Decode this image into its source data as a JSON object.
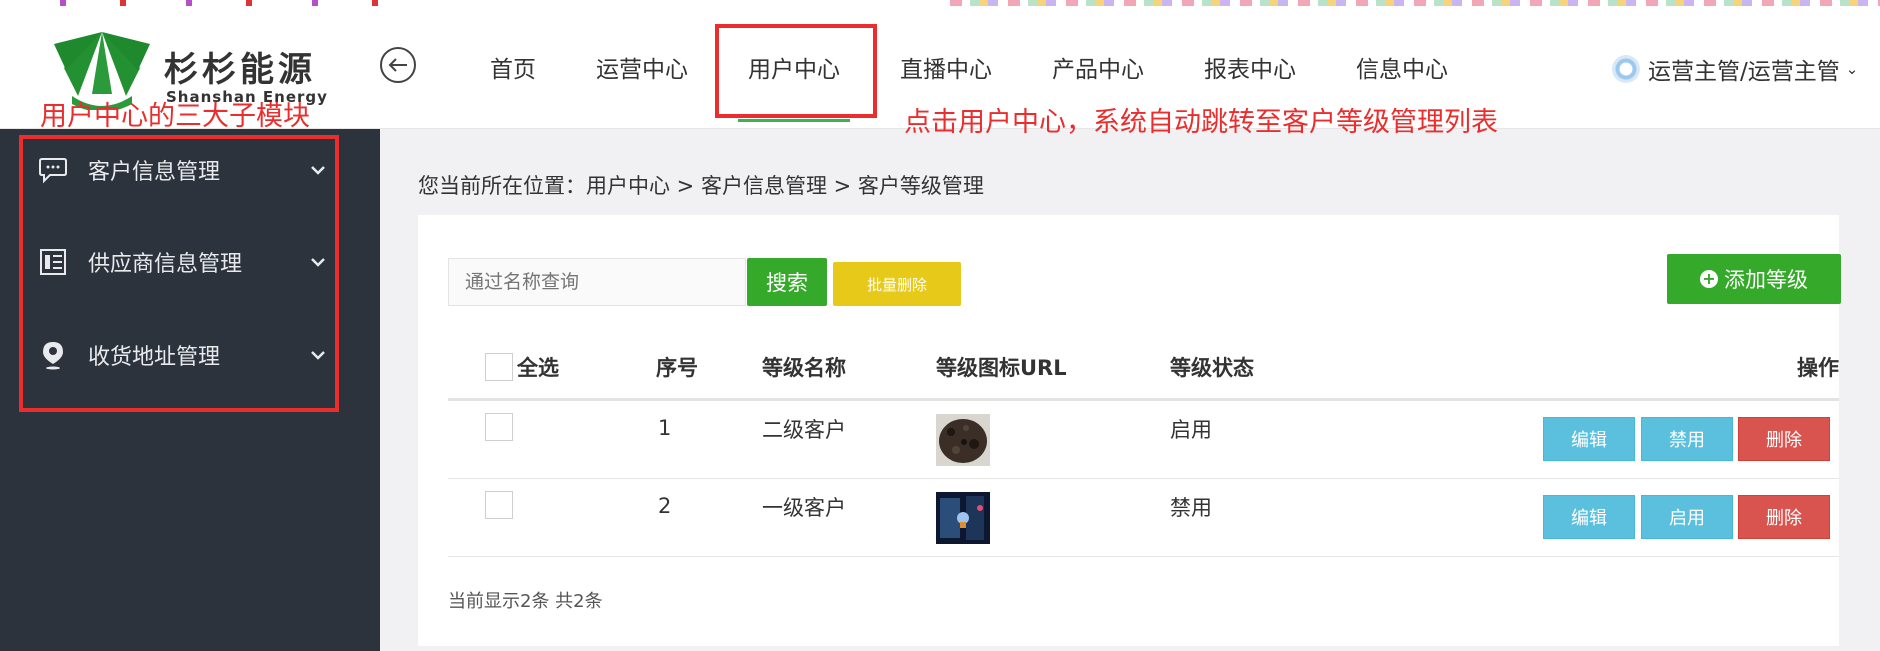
{
  "app": {
    "logo_cn": "杉杉能源",
    "logo_en": "Shanshan Energy"
  },
  "nav": {
    "items": [
      {
        "label": "首页"
      },
      {
        "label": "运营中心"
      },
      {
        "label": "用户中心",
        "active": true
      },
      {
        "label": "直播中心"
      },
      {
        "label": "产品中心"
      },
      {
        "label": "报表中心"
      },
      {
        "label": "信息中心"
      }
    ],
    "user": "运营主管/运营主管"
  },
  "annotations": {
    "sidebar_note": "用户中心的三大子模块",
    "nav_note": "点击用户中心，系统自动跳转至客户等级管理列表"
  },
  "sidebar": {
    "items": [
      {
        "label": "客户信息管理",
        "icon": "chat-bubble-icon"
      },
      {
        "label": "供应商信息管理",
        "icon": "document-icon"
      },
      {
        "label": "收货地址管理",
        "icon": "location-pin-icon"
      }
    ]
  },
  "breadcrumb": "您当前所在位置：用户中心 > 客户信息管理 > 客户等级管理",
  "toolbar": {
    "search_placeholder": "通过名称查询",
    "search_label": "搜索",
    "batch_delete_label": "批量删除",
    "add_label": "添加等级"
  },
  "table": {
    "headers": {
      "select_all": "全选",
      "index": "序号",
      "name": "等级名称",
      "icon_url": "等级图标URL",
      "status": "等级状态",
      "actions": "操作"
    },
    "rows": [
      {
        "index": "1",
        "name": "二级客户",
        "status": "启用",
        "edit": "编辑",
        "toggle": "禁用",
        "delete": "删除"
      },
      {
        "index": "2",
        "name": "一级客户",
        "status": "禁用",
        "edit": "编辑",
        "toggle": "启用",
        "delete": "删除"
      }
    ],
    "footer": "当前显示2条 共2条"
  },
  "colors": {
    "primary_green": "#35a92a",
    "sidebar_bg": "#2c333d",
    "annotation_red": "#ea2e2e",
    "info_blue": "#5bc0de",
    "danger_red": "#d9534f",
    "warning_yellow": "#e6c919"
  }
}
